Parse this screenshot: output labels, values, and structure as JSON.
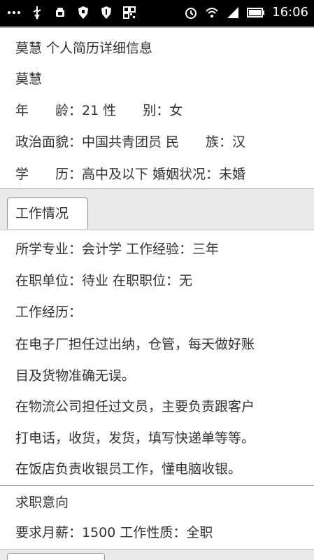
{
  "statusbar": {
    "time": "16:06",
    "left_icons": [
      "more-icon",
      "usb-icon",
      "android-icon",
      "shield-icon",
      "shield-icon",
      "app-icon"
    ],
    "right_icons": [
      "alarm-icon",
      "wifi-icon",
      "signal-icon",
      "battery-icon"
    ]
  },
  "resume": {
    "title": "莫慧 个人简历详细信息",
    "name": "莫慧",
    "row_age_gender": "年　　龄：21 性　　别：女",
    "row_politics_ethnic": "政治面貌：中国共青团员 民　　族：汉",
    "row_edu_marital": "学　　历：高中及以下 婚姻状况：未婚"
  },
  "work": {
    "tab_label": "工作情况",
    "major_exp": "所学专业：会计学 工作经验：三年",
    "unit_position": "在职单位：待业 在职职位：无",
    "history_label": "工作经历：",
    "history_lines": [
      "在电子厂担任过出纳，仓管，每天做好账",
      "目及货物准确无误。",
      "在物流公司担任过文员，主要负责跟客户",
      "打电话，收货，发货，填写快递单等等。",
      "在饭店负责收银员工作，懂电脑收银。"
    ]
  },
  "intent": {
    "heading": "求职意向",
    "salary_type": "要求月薪：1500 工作性质：全职"
  }
}
